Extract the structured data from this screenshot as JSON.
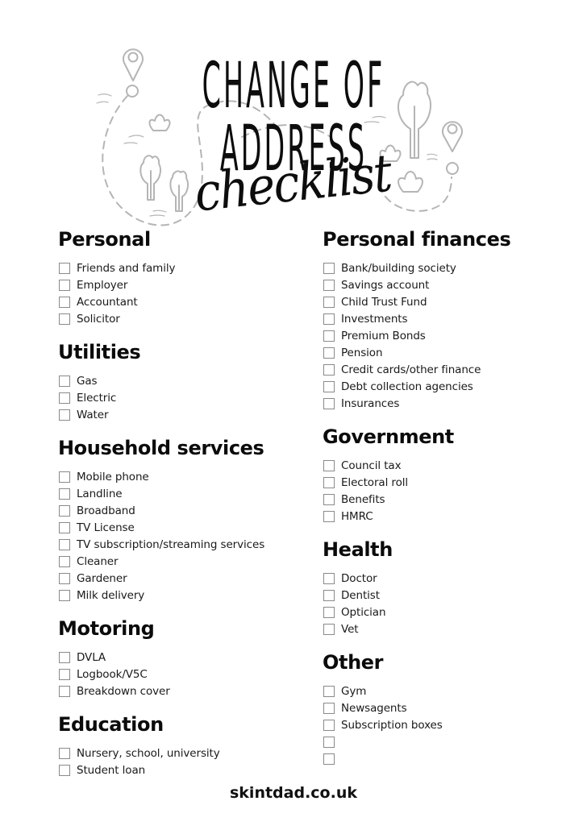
{
  "title": {
    "line1": "CHANGE OF",
    "line2": "ADDRESS",
    "script": "checklist"
  },
  "illustration": {
    "icons": [
      "map-pin-icon",
      "tree-icon",
      "bush-icon",
      "dashed-route-path"
    ],
    "stroke_color": "#b5b5b5"
  },
  "left_column": [
    {
      "heading": "Personal",
      "items": [
        "Friends and family",
        "Employer",
        "Accountant",
        "Solicitor"
      ]
    },
    {
      "heading": "Utilities",
      "items": [
        "Gas",
        "Electric",
        "Water"
      ]
    },
    {
      "heading": "Household services",
      "items": [
        "Mobile phone",
        "Landline",
        "Broadband",
        "TV License",
        "TV subscription/streaming services",
        "Cleaner",
        "Gardener",
        "Milk delivery"
      ]
    },
    {
      "heading": "Motoring",
      "items": [
        "DVLA",
        "Logbook/V5C",
        "Breakdown cover"
      ]
    },
    {
      "heading": "Education",
      "items": [
        "Nursery, school, university",
        "Student loan"
      ]
    }
  ],
  "right_column": [
    {
      "heading": "Personal finances",
      "items": [
        "Bank/building society",
        "Savings account",
        "Child Trust Fund",
        "Investments",
        "Premium Bonds",
        "Pension",
        "Credit cards/other finance",
        "Debt collection agencies",
        "Insurances"
      ]
    },
    {
      "heading": "Government",
      "items": [
        "Council tax",
        "Electoral roll",
        "Benefits",
        "HMRC"
      ]
    },
    {
      "heading": "Health",
      "items": [
        "Doctor",
        "Dentist",
        "Optician",
        "Vet"
      ]
    },
    {
      "heading": "Other",
      "items": [
        "Gym",
        "Newsagents",
        "Subscription boxes",
        "",
        ""
      ]
    }
  ],
  "footer": {
    "website": "skintdad.co.uk"
  }
}
